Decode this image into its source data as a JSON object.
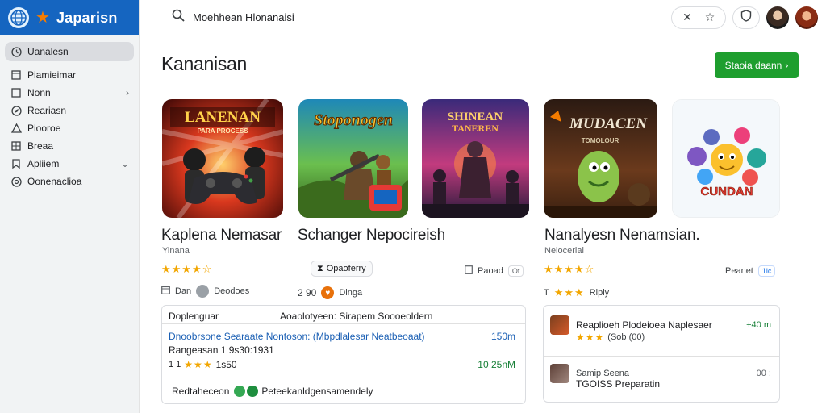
{
  "brand": {
    "name": "Japarisn"
  },
  "sidebar": {
    "items": [
      {
        "label": "Uanalesn",
        "icon": "clock-icon",
        "active": true
      },
      {
        "label": "Piamieimar",
        "icon": "square-icon"
      },
      {
        "label": "Nonn",
        "icon": "square-icon",
        "chevron": "›"
      },
      {
        "label": "Reariasn",
        "icon": "compass-icon"
      },
      {
        "label": "Piooroe",
        "icon": "triangle-icon"
      },
      {
        "label": "Breaa",
        "icon": "grid-icon"
      },
      {
        "label": "Apliiem",
        "icon": "bookmark-icon",
        "chevron": "⌄"
      },
      {
        "label": "Oonenaclioa",
        "icon": "settings-icon"
      }
    ]
  },
  "search": {
    "value": "Moehhean Hlonanaisi"
  },
  "main": {
    "title": "Kananisan",
    "cta_label": "Staoia daann",
    "cta_chevron": "›",
    "apps": [
      {
        "thumb_text": "LANENAN",
        "thumb_sub": "PARA PROCESS"
      },
      {
        "thumb_text": "Stoponogen"
      },
      {
        "thumb_text": "SHINEAN",
        "thumb_sub": "TANEREN"
      },
      {
        "thumb_text": "MUDACEN",
        "thumb_sub": "TOMOLOUR"
      },
      {
        "thumb_text": "CUNDAN"
      }
    ],
    "app1": {
      "title": "Kaplena Nemasar",
      "subtitle": "Yinana",
      "stars": "★★★★☆",
      "meta1": "Dan",
      "meta2": "Deodoes"
    },
    "app2": {
      "title": "Schanger Nepocireish",
      "chip": "Opaoferry",
      "price": "2 90",
      "meta": "Dinga"
    },
    "app3": {
      "title": "Nanalyesn Nenamsian.",
      "subtitle": "Nelocerial",
      "stars": "★★★★☆",
      "meta": "Peanet",
      "meta_tag": "1ic",
      "rating_prefix": "T",
      "rating_stars": "★★★",
      "rating_text": "Riply"
    },
    "app2_side": {
      "label": "Paoad",
      "tag": "Ot"
    }
  },
  "card_a": {
    "col1": "Doplenguar",
    "col2": "Aoaolotyeen: Sirapem Soooeoldern",
    "row1_text": "Dnoobrsone Searaate Nontoson: (Mbpdlalesar Neatbeoaat)",
    "row1_value": "150m",
    "row2_text": "Rangeasan 1 9s30:1931",
    "row3_stars": "★★★",
    "row3_prefix": "1 1",
    "row3_text": "1s50",
    "row3_value": "10 25nM",
    "footer_label": "Redtaheceon",
    "footer_text": "Peteekanldgensamendely"
  },
  "card_b": {
    "item1_title": "Reaplioeh Plodeioea Naplesaer",
    "item1_value": "+40 m",
    "item1_stars": "★★★",
    "item1_sub": "(Sob (00)",
    "item2_title": "Samip Seena",
    "item2_value": "00 :",
    "item2_sub": "TGOISS Preparatin"
  }
}
